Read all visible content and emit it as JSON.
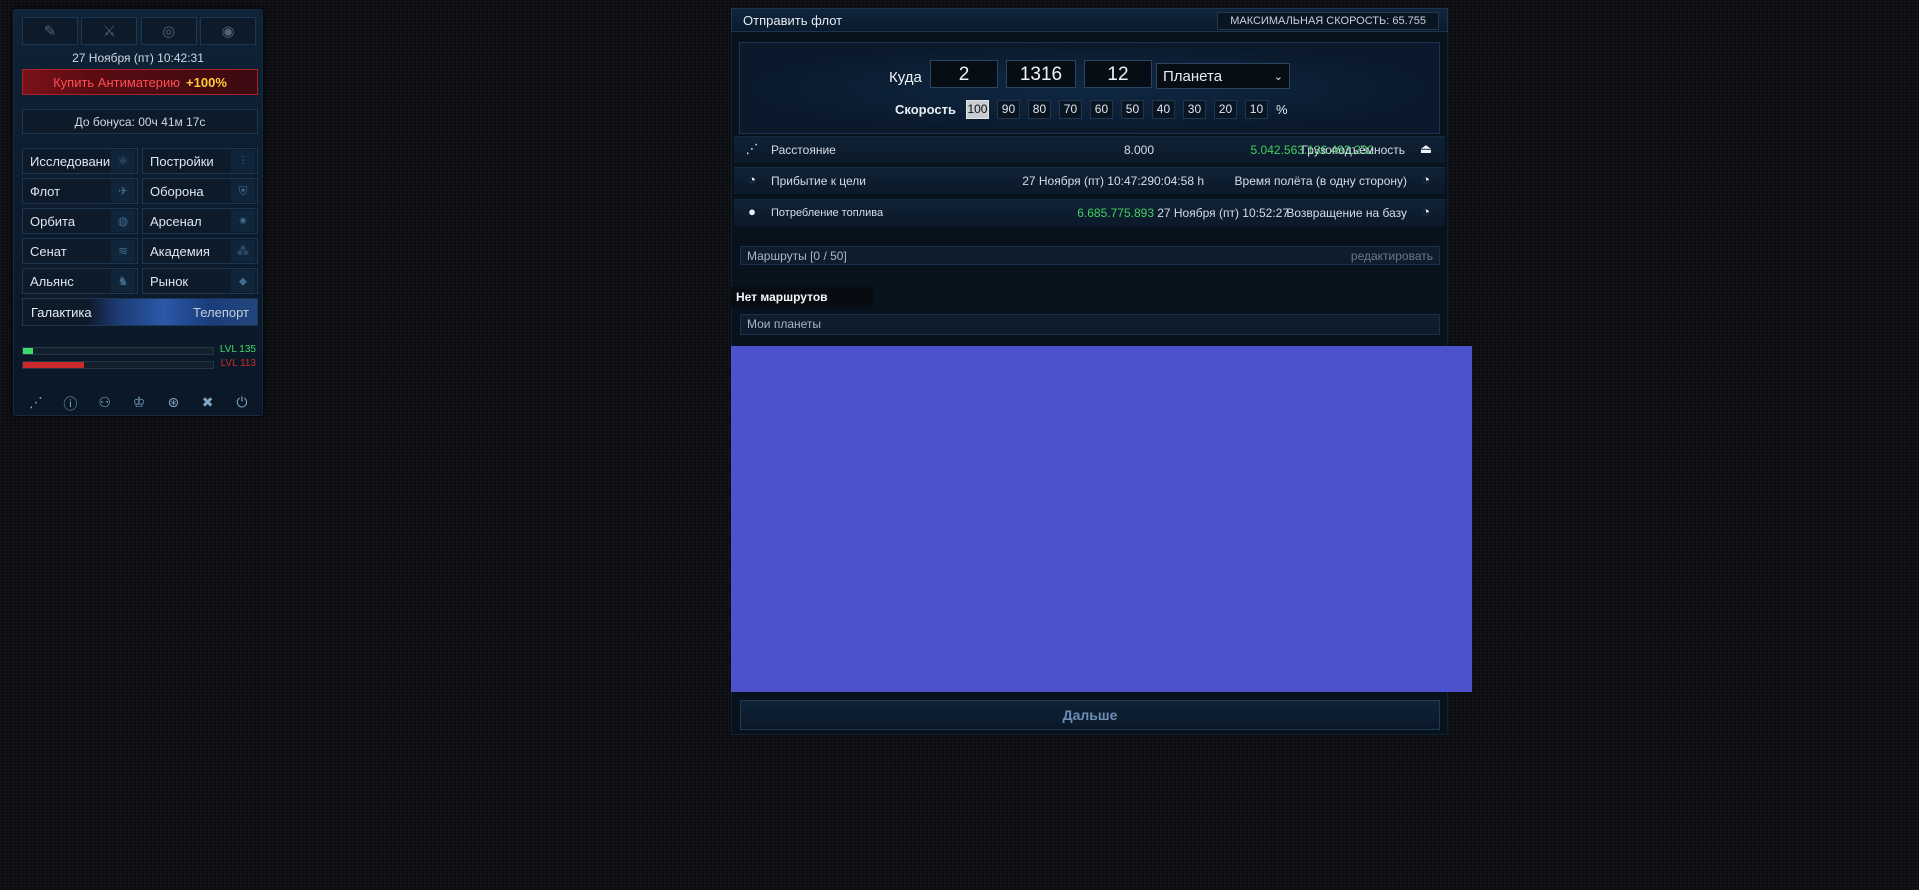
{
  "sidebar": {
    "top_icons": [
      {
        "icon": "pen-icon",
        "glyph": "✎"
      },
      {
        "icon": "crossed-swords-icon",
        "glyph": "⚔"
      },
      {
        "icon": "target-icon",
        "glyph": "◎"
      },
      {
        "icon": "eye-icon",
        "glyph": "◉"
      }
    ],
    "clock": "27 Ноября (пт) 10:42:31",
    "buy": {
      "label": "Купить Антиматерию",
      "bonus": "+100%"
    },
    "bonus_timer": "До бонуса: 00ч 41м 17с",
    "menu": [
      [
        {
          "label": "Исследовани",
          "icon": "research-icon",
          "glyph": "⚛"
        },
        {
          "label": "Постройки",
          "icon": "sliders-icon",
          "glyph": "⫶"
        }
      ],
      [
        {
          "label": "Флот",
          "icon": "ship-icon",
          "glyph": "✈"
        },
        {
          "label": "Оборона",
          "icon": "shield-icon",
          "glyph": "⛨"
        }
      ],
      [
        {
          "label": "Орбита",
          "icon": "orbit-icon",
          "glyph": "◍"
        },
        {
          "label": "Арсенал",
          "icon": "sun-icon",
          "glyph": "✷"
        }
      ],
      [
        {
          "label": "Сенат",
          "icon": "layers-icon",
          "glyph": "≋"
        },
        {
          "label": "Академия",
          "icon": "molecule-icon",
          "glyph": "⁂"
        }
      ],
      [
        {
          "label": "Альянс",
          "icon": "wolf-icon",
          "glyph": "♞"
        },
        {
          "label": "Рынок",
          "icon": "tag-icon",
          "glyph": "⬥"
        }
      ]
    ],
    "galaxy": "Галактика",
    "teleport": "Телепорт",
    "levels": [
      {
        "label": "LVL 135",
        "progress": 0.05,
        "color": "#3ddc6a"
      },
      {
        "label": "LVL 113",
        "progress": 0.32,
        "color": "#cc2a2a"
      }
    ],
    "bottom_icons": [
      {
        "icon": "share-icon",
        "glyph": "⋰"
      },
      {
        "icon": "info-icon",
        "glyph": "ⓘ"
      },
      {
        "icon": "users-icon",
        "glyph": "⚇"
      },
      {
        "icon": "medal-icon",
        "glyph": "♔"
      },
      {
        "icon": "lifebuoy-icon",
        "glyph": "⊛"
      },
      {
        "icon": "tools-icon",
        "glyph": "✖"
      },
      {
        "icon": "power-icon",
        "glyph": "⏻"
      }
    ]
  },
  "fleet": {
    "title": "Отправить флот",
    "max_speed": "МАКСИМАЛЬНАЯ СКОРОСТЬ: 65.755",
    "target_label": "Куда",
    "galaxy": "2",
    "system": "1316",
    "position": "12",
    "target_type": "Планета",
    "speed_label": "Скорость",
    "speeds": [
      "100",
      "90",
      "80",
      "70",
      "60",
      "50",
      "40",
      "30",
      "20",
      "10"
    ],
    "speed_active": "100",
    "percent": "%",
    "rows": {
      "distance_label": "Расстояние",
      "distance_value": "8.000",
      "capacity_value": "5.042.563.136.493.232",
      "capacity_label": "Грузоподъёмность",
      "arrival_label": "Прибытие к цели",
      "arrival_value": "27 Ноября (пт) 10:47:29",
      "duration_value": "0:04:58 h",
      "duration_label": "Время полёта (в одну сторону)",
      "fuel_label": "Потребление топлива",
      "fuel_value": "6.685.775.893",
      "return_value": "27 Ноября (пт) 10:52:27",
      "return_label": "Возвращение на базу"
    },
    "routes_label": "Маршруты [0 / 50]",
    "routes_edit": "редактировать",
    "no_routes": "Нет маршрутов",
    "my_planets": "Мои планеты",
    "next_button": "Дальше"
  }
}
